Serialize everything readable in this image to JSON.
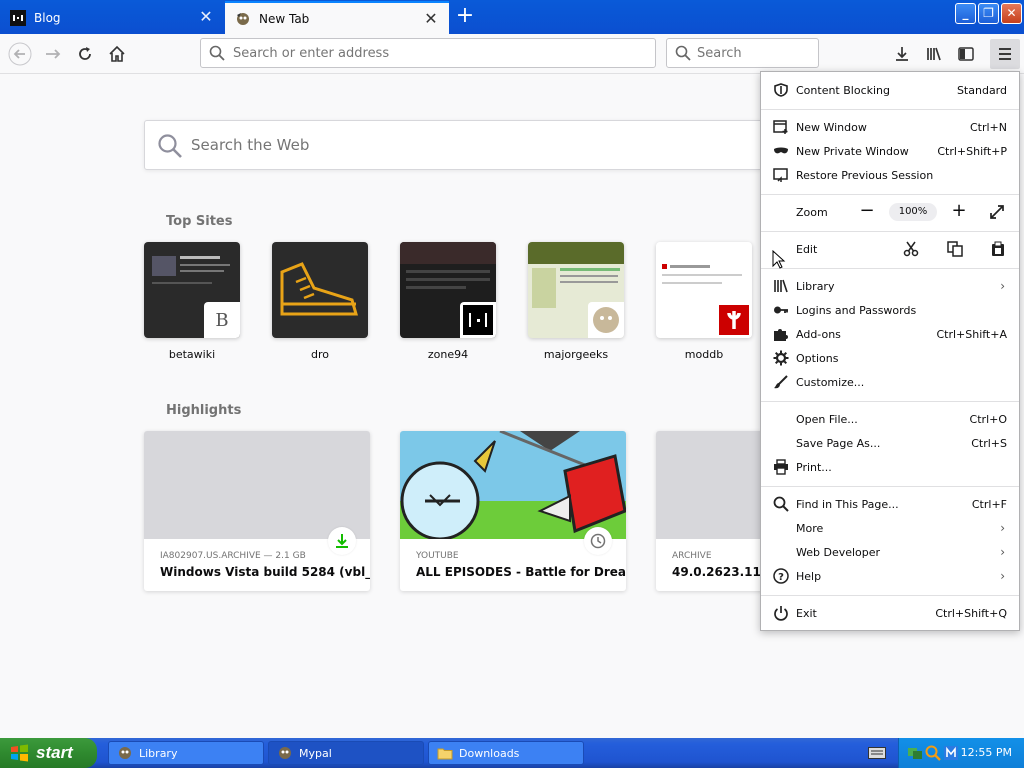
{
  "browser": {
    "tabs": [
      {
        "label": "Blog",
        "active": false
      },
      {
        "label": "New Tab",
        "active": true
      }
    ],
    "url_placeholder": "Search or enter address",
    "search_placeholder": "Search"
  },
  "newtab": {
    "web_search_placeholder": "Search the Web",
    "top_sites_title": "Top Sites",
    "top_sites": [
      {
        "name": "betawiki",
        "badge": "B"
      },
      {
        "name": "dro"
      },
      {
        "name": "zone94"
      },
      {
        "name": "majorgeeks"
      },
      {
        "name": "moddb"
      }
    ],
    "highlights_title": "Highlights",
    "highlights": [
      {
        "source": "IA802907.US.ARCHIVE — 2.1 GB",
        "title": "Windows Vista build 5284 (vbl_..."
      },
      {
        "source": "YOUTUBE",
        "title": "ALL EPISODES - Battle for Drea..."
      },
      {
        "source": "ARCHIVE",
        "title": "49.0.2623.112 C"
      }
    ]
  },
  "menu": {
    "content_blocking": {
      "label": "Content Blocking",
      "value": "Standard"
    },
    "new_window": {
      "label": "New Window",
      "key": "Ctrl+N"
    },
    "new_private_window": {
      "label": "New Private Window",
      "key": "Ctrl+Shift+P"
    },
    "restore_session": {
      "label": "Restore Previous Session"
    },
    "zoom": {
      "label": "Zoom",
      "value": "100%"
    },
    "edit": {
      "label": "Edit"
    },
    "library": {
      "label": "Library"
    },
    "logins": {
      "label": "Logins and Passwords"
    },
    "addons": {
      "label": "Add-ons",
      "key": "Ctrl+Shift+A"
    },
    "options": {
      "label": "Options"
    },
    "customize": {
      "label": "Customize..."
    },
    "open_file": {
      "label": "Open File...",
      "key": "Ctrl+O"
    },
    "save_page": {
      "label": "Save Page As...",
      "key": "Ctrl+S"
    },
    "print": {
      "label": "Print..."
    },
    "find": {
      "label": "Find in This Page...",
      "key": "Ctrl+F"
    },
    "more": {
      "label": "More"
    },
    "web_developer": {
      "label": "Web Developer"
    },
    "help": {
      "label": "Help"
    },
    "exit": {
      "label": "Exit",
      "key": "Ctrl+Shift+Q"
    }
  },
  "taskbar": {
    "start_label": "start",
    "items": [
      {
        "label": "Library"
      },
      {
        "label": "Mypal"
      },
      {
        "label": "Downloads"
      }
    ],
    "clock": "12:55 PM"
  },
  "colors": {
    "accent": "#0a84ff",
    "download_green": "#12bc00",
    "taskbar_blue": "#245edb",
    "start_green": "#3c9a3c"
  }
}
